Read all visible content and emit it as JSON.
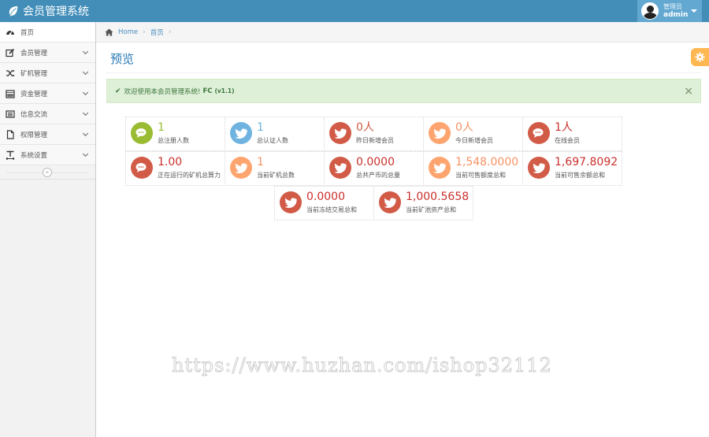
{
  "navbar": {
    "brand": "会员管理系统",
    "user_role": "管理员",
    "user_name": "admin"
  },
  "sidebar": {
    "items": [
      {
        "label": "首页",
        "icon": "tachometer-icon",
        "has_children": false
      },
      {
        "label": "会员管理",
        "icon": "edit-icon",
        "has_children": true
      },
      {
        "label": "矿机管理",
        "icon": "random-icon",
        "has_children": true
      },
      {
        "label": "资金管理",
        "icon": "calendar-icon",
        "has_children": true
      },
      {
        "label": "信息交流",
        "icon": "list-alt-icon",
        "has_children": true
      },
      {
        "label": "权限管理",
        "icon": "file-icon",
        "has_children": true
      },
      {
        "label": "系统设置",
        "icon": "text-width-icon",
        "has_children": true
      }
    ],
    "collapse_symbol": "«"
  },
  "breadcrumb": {
    "home": "Home",
    "current": "首页",
    "separator": "›"
  },
  "page": {
    "title": "预览"
  },
  "alert": {
    "check_symbol": "✔",
    "message": "欢迎使用本会员管理系统!",
    "brand": "FC",
    "version": "(v1.1)",
    "close_symbol": "×"
  },
  "stats": [
    {
      "value": "1",
      "label": "总注册人数",
      "color": "green",
      "icon": "comments-icon"
    },
    {
      "value": "1",
      "label": "总认证人数",
      "color": "blue",
      "icon": "twitter-icon"
    },
    {
      "value": "0人",
      "label": "昨日新增会员",
      "color": "red",
      "icon": "twitter-icon"
    },
    {
      "value": "0人",
      "label": "今日新增会员",
      "color": "orange",
      "icon": "twitter-icon"
    },
    {
      "value": "1人",
      "label": "在线会员",
      "color": "red",
      "icon": "comments-icon"
    },
    {
      "value": "1.00",
      "label": "正在运行的矿机总算力",
      "color": "red",
      "icon": "comments-icon"
    },
    {
      "value": "1",
      "label": "当前矿机总数",
      "color": "orange",
      "icon": "twitter-icon"
    },
    {
      "value": "0.0000",
      "label": "总共产币的总量",
      "color": "red",
      "icon": "twitter-icon"
    },
    {
      "value": "1,548.0000",
      "label": "当前可售额度总和",
      "color": "orange",
      "icon": "twitter-icon"
    },
    {
      "value": "1,697.8092",
      "label": "当前可售余额总和",
      "color": "red",
      "icon": "twitter-icon"
    },
    {
      "value": "0.0000",
      "label": "当前冻结交易总和",
      "color": "red",
      "icon": "twitter-icon"
    },
    {
      "value": "1,000.5658",
      "label": "当前矿池资产总和",
      "color": "red",
      "icon": "twitter-icon"
    }
  ],
  "watermark": "https://www.huzhan.com/ishop32112",
  "colors": {
    "navbar": "#438eb9",
    "user_box": "#62a8d1",
    "green": "#9abc32",
    "blue": "#6fb3e0",
    "red": "#d15b47",
    "orange": "#fea56f",
    "alert_bg": "#dff0d8",
    "settings": "#ffb752"
  }
}
